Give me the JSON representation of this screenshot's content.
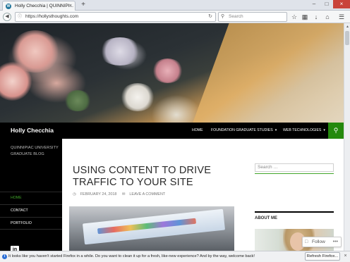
{
  "browser": {
    "tab_title": "Holly Checchia | QUINNIPI...",
    "tab_close": "×",
    "new_tab": "+",
    "url": "https://hollysthoughts.com",
    "search_placeholder": "Search",
    "win_min": "–",
    "win_max": "□",
    "win_close": "×"
  },
  "site": {
    "title": "Holly Checchia",
    "menu": [
      {
        "label": "HOME"
      },
      {
        "label": "FOUNDATION GRADUATE STUDIES"
      },
      {
        "label": "WEB TECHNOLOGIES"
      }
    ],
    "description": "QUINNIPIAC UNIVERSITY GRADUATE BLOG",
    "left_nav": [
      {
        "label": "HOME",
        "active": true
      },
      {
        "label": "CONTACT",
        "active": false
      },
      {
        "label": "PORTFOLIO",
        "active": false
      }
    ],
    "social": "in"
  },
  "post": {
    "title": "USING CONTENT TO DRIVE TRAFFIC TO YOUR SITE",
    "date": "FEBRUARY 24, 2018",
    "comment": "LEAVE A COMMENT"
  },
  "sidebar": {
    "search_placeholder": "Search …",
    "about_heading": "ABOUT ME"
  },
  "follow": {
    "label": "Follow",
    "more": "•••"
  },
  "notification": {
    "message": "It looks like you haven't started Firefox in a while. Do you want to clean it up for a fresh, like-new experience? And by the way, welcome back!",
    "button": "Refresh Firefox...",
    "close": "×"
  },
  "colors": {
    "accent": "#24890d",
    "site_bg": "#000000"
  }
}
